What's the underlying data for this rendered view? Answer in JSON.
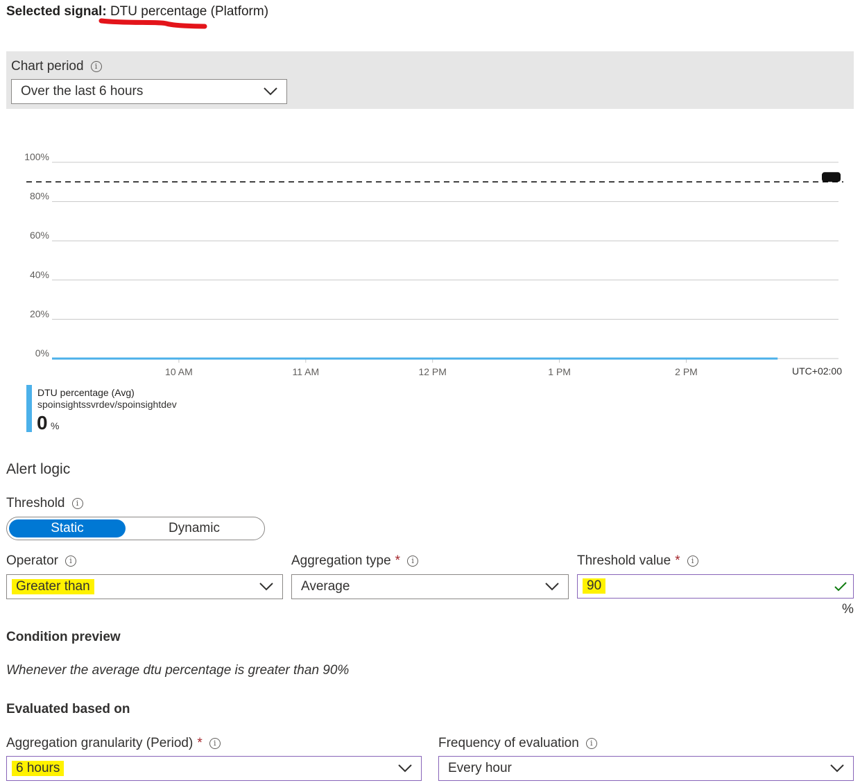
{
  "signal": {
    "prefix": "Selected signal:",
    "name": "DTU percentage",
    "source": "(Platform)"
  },
  "chart_period": {
    "label": "Chart period",
    "value": "Over the last 6 hours"
  },
  "chart_data": {
    "type": "line",
    "y_ticks": [
      "100%",
      "80%",
      "60%",
      "40%",
      "20%",
      "0%"
    ],
    "x_ticks": [
      "10 AM",
      "11 AM",
      "12 PM",
      "1 PM",
      "2 PM"
    ],
    "timezone": "UTC+02:00",
    "ylim": [
      0,
      100
    ],
    "threshold": 90,
    "grid": true,
    "series": [
      {
        "name": "DTU percentage (Avg)",
        "resource": "spoinsightssvrdev/spoinsightdev",
        "color": "#4cb1ea",
        "x": [
          "9:30 AM",
          "2:55 PM"
        ],
        "values": [
          0,
          0
        ]
      }
    ],
    "legend": {
      "series_name": "DTU percentage (Avg)",
      "resource": "spoinsightssvrdev/spoinsightdev",
      "value": "0",
      "unit": "%"
    }
  },
  "alert_logic": {
    "title": "Alert logic",
    "threshold_label": "Threshold",
    "threshold_options": [
      "Static",
      "Dynamic"
    ],
    "threshold_selected": "Static",
    "operator_label": "Operator",
    "operator_value": "Greater than",
    "aggregation_type_label": "Aggregation type",
    "aggregation_type_value": "Average",
    "threshold_value_label": "Threshold value",
    "threshold_value": "90",
    "threshold_unit": "%",
    "required_mark": "*"
  },
  "condition_preview": {
    "title": "Condition preview",
    "text": "Whenever the average dtu percentage is greater than 90%"
  },
  "evaluated": {
    "title": "Evaluated based on",
    "granularity_label": "Aggregation granularity (Period)",
    "granularity_value": "6 hours",
    "frequency_label": "Frequency of evaluation",
    "frequency_value": "Every hour"
  },
  "icons": {
    "info": "ⓘ",
    "check": "✓"
  },
  "colors": {
    "accent": "#0078d4",
    "highlight": "#fff200",
    "annotation": "#e3141a",
    "series": "#4cb1ea"
  }
}
